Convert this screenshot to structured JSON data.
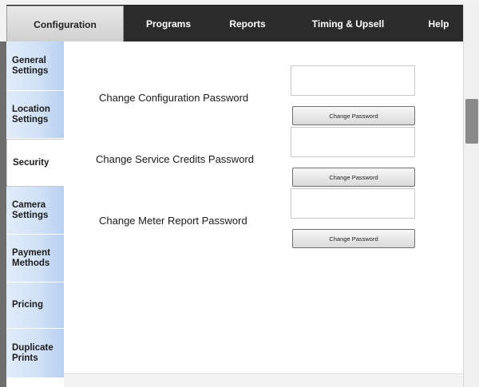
{
  "top_tabs": [
    {
      "label": "Configuration",
      "active": true
    },
    {
      "label": "Programs",
      "active": false
    },
    {
      "label": "Reports",
      "active": false
    },
    {
      "label": "Timing & Upsell",
      "active": false
    },
    {
      "label": "Help",
      "active": false
    }
  ],
  "sidebar": {
    "items": [
      {
        "label": "General\nSettings",
        "active": false
      },
      {
        "label": "Location\nSettings",
        "active": false
      },
      {
        "label": "Security",
        "active": true
      },
      {
        "label": "Camera\nSettings",
        "active": false
      },
      {
        "label": "Payment\nMethods",
        "active": false
      },
      {
        "label": "Pricing",
        "active": false
      },
      {
        "label": "Duplicate\nPrints",
        "active": false
      }
    ]
  },
  "security": {
    "rows": [
      {
        "label": "Change Configuration Password",
        "input_value": "",
        "button_label": "Change Password"
      },
      {
        "label": "Change Service Credits Password",
        "input_value": "",
        "button_label": "Change Password"
      },
      {
        "label": "Change Meter Report Password",
        "input_value": "",
        "button_label": "Change Password"
      }
    ]
  },
  "colors": {
    "topbar_bg": "#2b2b2b",
    "active_tab_bg": "#d9d9d9",
    "sidebar_item_bg": "#cfe0f6",
    "content_bg": "#ffffff"
  }
}
